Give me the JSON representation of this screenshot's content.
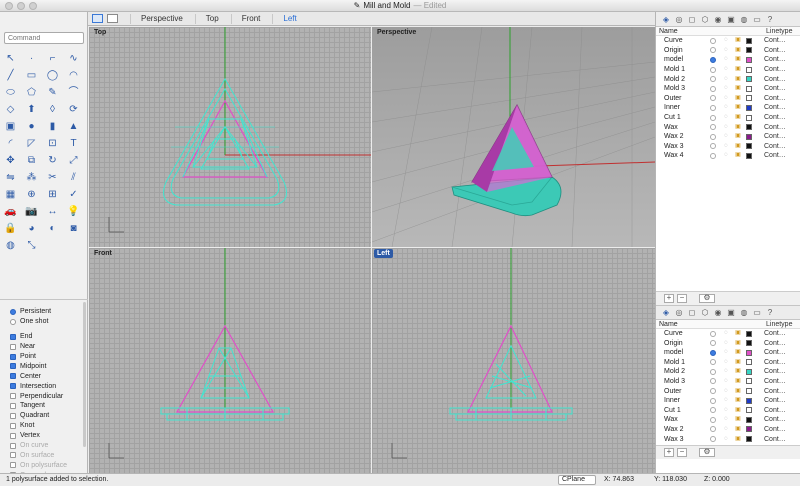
{
  "window": {
    "title": "Mill and Mold",
    "subtitle": "— Edited",
    "app_icon": "rhino-icon"
  },
  "toolbar": {
    "viewports": [
      "Perspective",
      "Top",
      "Front",
      "Left"
    ],
    "active_viewport_tab": "Left"
  },
  "command": {
    "placeholder": "Command"
  },
  "tool_icons": [
    "select-arrow-icon",
    "point-icon",
    "polyline-icon",
    "curve-icon",
    "line-icon",
    "rectangle-icon",
    "circle-icon",
    "arc-icon",
    "ellipse-icon",
    "polygon-icon",
    "freeform-icon",
    "blend-icon",
    "surface-icon",
    "extrude-icon",
    "loft-icon",
    "revolve-icon",
    "box-icon",
    "sphere-icon",
    "cylinder-icon",
    "cone-icon",
    "fillet-icon",
    "chamfer-icon",
    "offset-icon",
    "text-icon",
    "move-icon",
    "copy-icon",
    "rotate-icon",
    "scale-icon",
    "mirror-icon",
    "array-icon",
    "trim-icon",
    "split-icon",
    "grid-icon",
    "boolean-icon",
    "group-icon",
    "check-icon",
    "car-icon",
    "snapshot-icon",
    "dimension-icon",
    "light-icon",
    "lock-icon",
    "color-wheel-icon",
    "render-icon",
    "camera-icon",
    "globe-icon",
    "transform-icon"
  ],
  "osnap": {
    "mode_persistent": "Persistent",
    "mode_oneshot": "One shot",
    "items": [
      {
        "label": "End",
        "checked": true
      },
      {
        "label": "Near",
        "checked": false
      },
      {
        "label": "Point",
        "checked": true
      },
      {
        "label": "Midpoint",
        "checked": true
      },
      {
        "label": "Center",
        "checked": true
      },
      {
        "label": "Intersection",
        "checked": true
      },
      {
        "label": "Perpendicular",
        "checked": false
      },
      {
        "label": "Tangent",
        "checked": false
      },
      {
        "label": "Quadrant",
        "checked": false
      },
      {
        "label": "Knot",
        "checked": false
      },
      {
        "label": "Vertex",
        "checked": false
      },
      {
        "label": "On curve",
        "checked": false,
        "disabled": true
      },
      {
        "label": "On surface",
        "checked": false,
        "disabled": true
      },
      {
        "label": "On polysurface",
        "checked": false,
        "disabled": true
      },
      {
        "label": "On mesh",
        "checked": false,
        "disabled": true
      }
    ]
  },
  "viewports": {
    "top": "Top",
    "perspective": "Perspective",
    "front": "Front",
    "left": "Left"
  },
  "layers": {
    "col_name": "Name",
    "col_linetype": "Linetype",
    "rows": [
      {
        "name": "Curve",
        "color": "#111111",
        "current": false,
        "line": "Cont…"
      },
      {
        "name": "Origin",
        "color": "#111111",
        "current": false,
        "line": "Cont…"
      },
      {
        "name": "model",
        "color": "#e04fc8",
        "current": true,
        "line": "Cont…"
      },
      {
        "name": "Mold 1",
        "color": "#ffffff",
        "current": false,
        "line": "Cont…"
      },
      {
        "name": "Mold 2",
        "color": "#37d6c4",
        "current": false,
        "line": "Cont…"
      },
      {
        "name": "Mold 3",
        "color": "#ffffff",
        "current": false,
        "line": "Cont…"
      },
      {
        "name": "Outer",
        "color": "#ffffff",
        "current": false,
        "line": "Cont…"
      },
      {
        "name": "Inner",
        "color": "#1f3cc8",
        "current": false,
        "line": "Cont…"
      },
      {
        "name": "Cut 1",
        "color": "#ffffff",
        "current": false,
        "line": "Cont…"
      },
      {
        "name": "Wax",
        "color": "#111111",
        "current": false,
        "line": "Cont…"
      },
      {
        "name": "Wax 2",
        "color": "#8a1a8a",
        "current": false,
        "line": "Cont…"
      },
      {
        "name": "Wax 3",
        "color": "#111111",
        "current": false,
        "line": "Cont…"
      },
      {
        "name": "Wax 4",
        "color": "#111111",
        "current": false,
        "line": "Cont…"
      }
    ]
  },
  "status": {
    "message": "1 polysurface added to selection.",
    "cplane": "CPlane",
    "x": "X: 74.863",
    "y": "Y: 118.030",
    "z": "Z: 0.000"
  }
}
